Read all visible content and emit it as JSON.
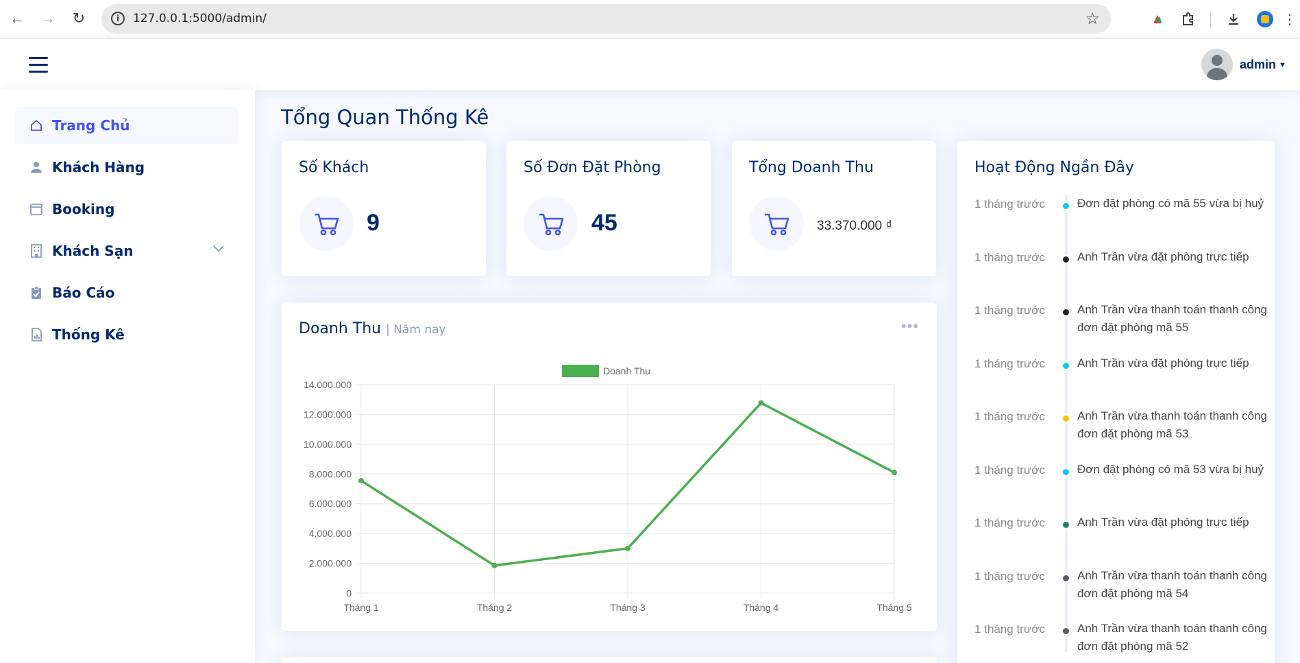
{
  "browser": {
    "url": "127.0.0.1:5000/admin/"
  },
  "header": {
    "user_name": "admin"
  },
  "sidebar": {
    "items": [
      {
        "label": "Trang Chủ",
        "icon": "home-icon",
        "active": true
      },
      {
        "label": "Khách Hàng",
        "icon": "person-icon"
      },
      {
        "label": "Booking",
        "icon": "calendar-icon"
      },
      {
        "label": "Khách Sạn",
        "icon": "building-icon",
        "has_submenu": true
      },
      {
        "label": "Báo Cáo",
        "icon": "clipboard-icon"
      },
      {
        "label": "Thống Kê",
        "icon": "report-icon"
      }
    ]
  },
  "main": {
    "page_title": "Tổng Quan Thống Kê",
    "stats": [
      {
        "title": "Số Khách",
        "value": "9",
        "icon": "cart-icon"
      },
      {
        "title": "Số Đơn Đặt Phòng",
        "value": "45",
        "icon": "cart-icon"
      },
      {
        "title": "Tổng Doanh Thu",
        "value": "33.370.000 ₫",
        "icon": "cart-icon"
      }
    ],
    "revenue_card": {
      "title": "Doanh Thu",
      "subtitle": "| Năm nay",
      "menu_icon": "more-dots-icon"
    },
    "activity": {
      "title": "Hoạt Động Ngần Đây",
      "items": [
        {
          "time": "1 tháng trước",
          "text": "Đơn đặt phòng có mã 55 vừa bị huỷ",
          "color": "#0dcaf0"
        },
        {
          "time": "1 tháng trước",
          "text": "Anh Trần vừa đặt phòng trực tiếp",
          "color": "#212529"
        },
        {
          "time": "1 tháng trước",
          "text": "Anh Trần vừa thanh toán thanh công đơn đặt phòng mã 55",
          "color": "#212529"
        },
        {
          "time": "1 tháng trước",
          "text": "Anh Trần vừa đặt phòng trực tiếp",
          "color": "#0dcaf0"
        },
        {
          "time": "1 tháng trước",
          "text": "Anh Trần vừa thanh toán thanh công đơn đặt phòng mã 53",
          "color": "#ffc107"
        },
        {
          "time": "1 tháng trước",
          "text": "Đơn đặt phòng có mã 53 vừa bị huỷ",
          "color": "#0dcaf0"
        },
        {
          "time": "1 tháng trước",
          "text": "Anh Trần vừa đặt phòng trực tiếp",
          "color": "#198754"
        },
        {
          "time": "1 tháng trước",
          "text": "Anh Trần vừa thanh toán thanh công đơn đặt phòng mã 54",
          "color": "#595c5f"
        },
        {
          "time": "1 tháng trước",
          "text": "Anh Trần vừa thanh toán thanh công đơn đặt phòng mã 52",
          "color": "#595c5f"
        }
      ]
    }
  },
  "chart_data": {
    "type": "line",
    "categories": [
      "Tháng 1",
      "Tháng 2",
      "Tháng 3",
      "Tháng 4",
      "Tháng 5"
    ],
    "series": [
      {
        "name": "Doanh Thu",
        "values": [
          7550000,
          1850000,
          3000000,
          12770000,
          8100000
        ],
        "color": "#4caf50"
      }
    ],
    "yticks": [
      "0",
      "2.000.000",
      "4.000.000",
      "6.000.000",
      "8.000.000",
      "10.000.000",
      "12.000.000",
      "14.000.000"
    ],
    "ylim": [
      0,
      14000000
    ],
    "grid": true,
    "legend": "top"
  }
}
